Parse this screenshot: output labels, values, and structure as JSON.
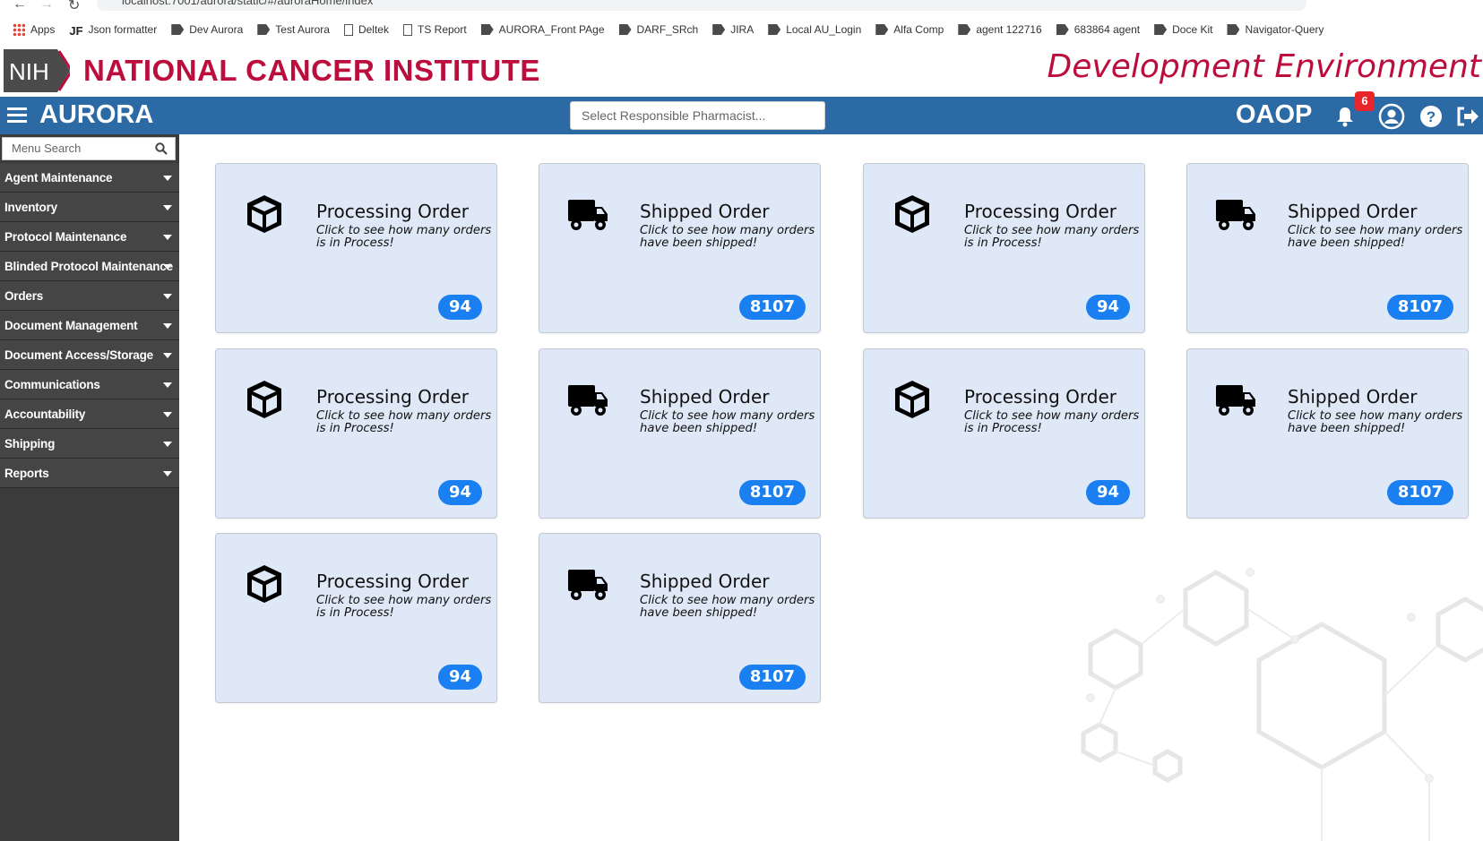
{
  "browser": {
    "url": "localhost:7001/aurora/static/#/auroraHome/index",
    "bookmarks": [
      {
        "label": "Apps",
        "icon": "apps-grid-icon"
      },
      {
        "label": "Json formatter",
        "icon": "jf-icon"
      },
      {
        "label": "Dev Aurora",
        "icon": "bookmark-icon"
      },
      {
        "label": "Test Aurora",
        "icon": "bookmark-icon"
      },
      {
        "label": "Deltek",
        "icon": "page-icon"
      },
      {
        "label": "TS Report",
        "icon": "page-icon"
      },
      {
        "label": "AURORA_Front PAge",
        "icon": "bookmark-icon"
      },
      {
        "label": "DARF_SRch",
        "icon": "bookmark-icon"
      },
      {
        "label": "JIRA",
        "icon": "jira-icon"
      },
      {
        "label": "Local AU_Login",
        "icon": "bookmark-icon"
      },
      {
        "label": "Alfa Comp",
        "icon": "bookmark-icon"
      },
      {
        "label": "agent 122716",
        "icon": "bookmark-icon"
      },
      {
        "label": "683864 agent",
        "icon": "bookmark-icon"
      },
      {
        "label": "Doce Kit",
        "icon": "bookmark-icon"
      },
      {
        "label": "Navigator-Query",
        "icon": "bookmark-icon"
      }
    ]
  },
  "header": {
    "logo_text": "NIH",
    "institute": "NATIONAL CANCER INSTITUTE",
    "environment": "Development Environment"
  },
  "appbar": {
    "title": "AURORA",
    "pharmacist_placeholder": "Select Responsible Pharmacist...",
    "org": "OAOP",
    "notification_count": "6"
  },
  "sidebar": {
    "search_placeholder": "Menu Search",
    "items": [
      "Agent Maintenance",
      "Inventory",
      "Protocol Maintenance",
      "Blinded Protocol Maintenance",
      "Orders",
      "Document Management",
      "Document Access/Storage",
      "Communications",
      "Accountability",
      "Shipping",
      "Reports"
    ]
  },
  "cards": [
    {
      "title": "Processing Order",
      "desc": "Click to see how many orders is in Process!",
      "count": "94",
      "icon": "box-icon"
    },
    {
      "title": "Shipped Order",
      "desc": "Click to see how many orders have been shipped!",
      "count": "8107",
      "icon": "truck-icon"
    },
    {
      "title": "Processing Order",
      "desc": "Click to see how many orders is in Process!",
      "count": "94",
      "icon": "box-icon"
    },
    {
      "title": "Shipped Order",
      "desc": "Click to see how many orders have been shipped!",
      "count": "8107",
      "icon": "truck-icon"
    },
    {
      "title": "Processing Order",
      "desc": "Click to see how many orders is in Process!",
      "count": "94",
      "icon": "box-icon"
    },
    {
      "title": "Shipped Order",
      "desc": "Click to see how many orders have been shipped!",
      "count": "8107",
      "icon": "truck-icon"
    },
    {
      "title": "Processing Order",
      "desc": "Click to see how many orders is in Process!",
      "count": "94",
      "icon": "box-icon"
    },
    {
      "title": "Shipped Order",
      "desc": "Click to see how many orders have been shipped!",
      "count": "8107",
      "icon": "truck-icon"
    },
    {
      "title": "Processing Order",
      "desc": "Click to see how many orders is in Process!",
      "count": "94",
      "icon": "box-icon"
    },
    {
      "title": "Shipped Order",
      "desc": "Click to see how many orders have been shipped!",
      "count": "8107",
      "icon": "truck-icon"
    }
  ],
  "colors": {
    "brand_red": "#bb0e3d",
    "appbar_blue": "#2c6aa6",
    "sidebar_dark": "#3b3b3b",
    "card_bg": "#dfe8f7",
    "count_badge": "#1a7ff0",
    "notif_badge": "#e8262c"
  }
}
